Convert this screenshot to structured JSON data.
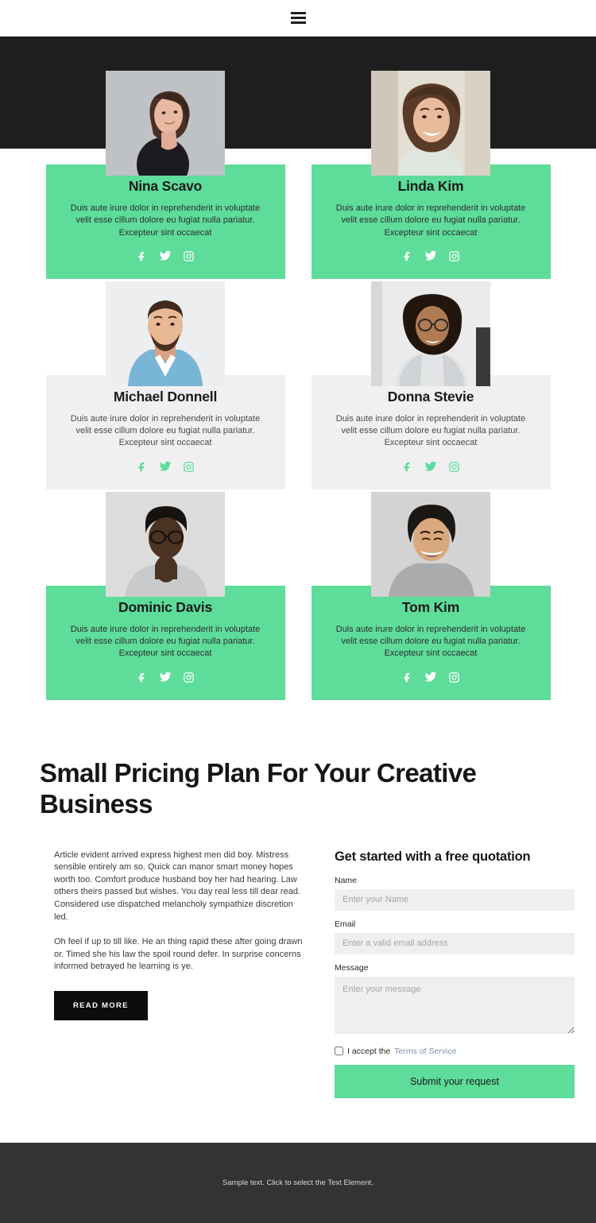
{
  "header": {
    "menu_icon": "hamburger-menu-icon"
  },
  "team": {
    "members": [
      {
        "name": "Nina Scavo",
        "bio": "Duis aute irure dolor in reprehenderit in voluptate velit esse cillum dolore eu fugiat nulla pariatur. Excepteur sint occaecat",
        "card_style": "green",
        "socials": [
          "facebook",
          "twitter",
          "instagram"
        ]
      },
      {
        "name": "Linda Kim",
        "bio": "Duis aute irure dolor in reprehenderit in voluptate velit esse cillum dolore eu fugiat nulla pariatur. Excepteur sint occaecat",
        "card_style": "green",
        "socials": [
          "facebook",
          "twitter",
          "instagram"
        ]
      },
      {
        "name": "Michael Donnell",
        "bio": "Duis aute irure dolor in reprehenderit in voluptate velit esse cillum dolore eu fugiat nulla pariatur. Excepteur sint occaecat",
        "card_style": "gray",
        "socials": [
          "facebook",
          "twitter",
          "instagram"
        ]
      },
      {
        "name": "Donna Stevie",
        "bio": "Duis aute irure dolor in reprehenderit in voluptate velit esse cillum dolore eu fugiat nulla pariatur. Excepteur sint occaecat",
        "card_style": "gray",
        "socials": [
          "facebook",
          "twitter",
          "instagram"
        ]
      },
      {
        "name": "Dominic Davis",
        "bio": "Duis aute irure dolor in reprehenderit in voluptate velit esse cillum dolore eu fugiat nulla pariatur. Excepteur sint occaecat",
        "card_style": "green",
        "socials": [
          "facebook",
          "twitter",
          "instagram"
        ]
      },
      {
        "name": "Tom Kim",
        "bio": "Duis aute irure dolor in reprehenderit in voluptate velit esse cillum dolore eu fugiat nulla pariatur. Excepteur sint occaecat",
        "card_style": "green",
        "socials": [
          "facebook",
          "twitter",
          "instagram"
        ]
      }
    ]
  },
  "pricing": {
    "title": "Small Pricing Plan For Your Creative Business",
    "paragraph_1": "Article evident arrived express highest men did boy. Mistress sensible entirely am so. Quick can manor smart money hopes worth too. Comfort produce husband boy her had hearing. Law others theirs passed but wishes. You day real less till dear read. Considered use dispatched melancholy sympathize discretion led.",
    "paragraph_2": "Oh feel if up to till like. He an thing rapid these after going drawn or. Timed she his law the spoil round defer. In surprise concerns informed betrayed he learning is ye.",
    "read_more_label": "READ MORE"
  },
  "form": {
    "title": "Get started with a free quotation",
    "name_label": "Name",
    "name_placeholder": "Enter your Name",
    "name_value": "",
    "email_label": "Email",
    "email_placeholder": "Enter a valid email address",
    "email_value": "",
    "message_label": "Message",
    "message_placeholder": "Enter your message",
    "message_value": "",
    "accept_text": "I accept the",
    "terms_link_label": "Terms of Service",
    "accept_checked": false,
    "submit_label": "Submit your request"
  },
  "footer": {
    "text": "Sample text. Click to select the Text Element."
  },
  "colors": {
    "accent_green": "#5ddc9a",
    "band_black": "#1e1e1e",
    "card_gray": "#f0f0f0",
    "footer_gray": "#333333",
    "link_blue": "#7b93a8",
    "button_black": "#0d0d0d"
  }
}
